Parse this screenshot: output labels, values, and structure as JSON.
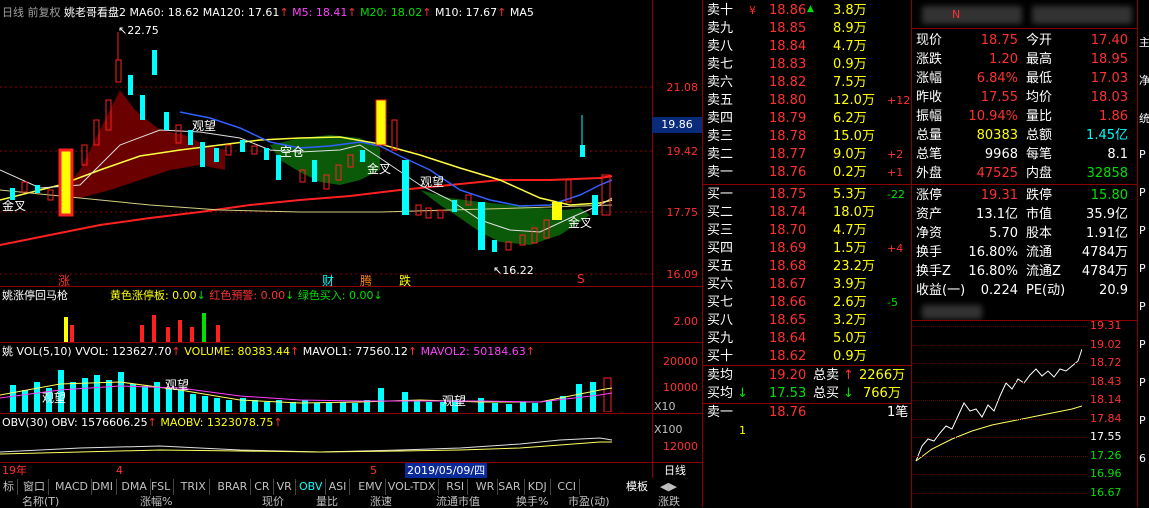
{
  "chart_header": {
    "period": "日线 前复权",
    "indicator": "姚老哥看盘2",
    "ma60": "MA60: 18.62",
    "ma120": "MA120: 17.61",
    "m5": "M5: 18.41",
    "m20": "M20: 18.02",
    "m10": "M10: 17.67",
    "ma_more": "MA5"
  },
  "price_axis": [
    "21.08",
    "19.42",
    "17.75",
    "16.09"
  ],
  "current_price_tag": "19.86",
  "annotations": {
    "high": "22.75",
    "low": "16.22",
    "guanwang1": "观望",
    "guanwang2": "观望",
    "kongcang": "空仓",
    "jinchai1": "金叉",
    "jinchai2": "金叉",
    "jinchai3": "金叉",
    "zhang": "涨",
    "cai": "财",
    "sheng": "腾",
    "die": "跌",
    "s": "S"
  },
  "limit_panel": {
    "title": "姚涨停回马枪",
    "yellow": "黄色涨停板: 0.00",
    "red": "红色預警: 0.00",
    "green": "绿色买入: 0.00",
    "axis": "2.00"
  },
  "vol_panel": {
    "title": "姚 VOL(5,10)",
    "vvol": "VVOL: 123627.70",
    "volume": "VOLUME: 80383.44",
    "mavol1": "MAVOL1: 77560.12",
    "mavol2": "MAVOL2: 50184.63",
    "axis": [
      "20000",
      "10000",
      "X10"
    ],
    "guanwang_a": "观望",
    "guanwang_b": "观望",
    "guanwang_c": "观望"
  },
  "obv_panel": {
    "title": "OBV(30)",
    "obv": "OBV: 1576606.25",
    "maobv": "MAOBV: 1323078.75",
    "axis": [
      "X100",
      "12000"
    ]
  },
  "date_bar": {
    "left": "19年",
    "m4": "4",
    "m5": "5",
    "selected": "2019/05/09/四",
    "period_btn": "日线"
  },
  "tabs": [
    "标",
    "窗口",
    "MACD",
    "DMI",
    "DMA",
    "FSL",
    "TRIX",
    "BRAR",
    "CR",
    "VR",
    "OBV",
    "ASI",
    "EMV",
    "VOL-TDX",
    "RSI",
    "WR",
    "SAR",
    "KDJ",
    "CCI"
  ],
  "tabs_active": "OBV",
  "tabs_right": "模板",
  "bottom_cols": [
    "名称(T)",
    "涨幅%",
    "现价",
    "量比",
    "涨速",
    "流通市值",
    "换手%",
    "市盈(动)",
    "涨跌"
  ],
  "orderbook": {
    "sell": [
      {
        "label": "卖十",
        "price": "18.86",
        "vol": "3.8万",
        "chg": ""
      },
      {
        "label": "卖九",
        "price": "18.85",
        "vol": "8.9万",
        "chg": ""
      },
      {
        "label": "卖八",
        "price": "18.84",
        "vol": "4.7万",
        "chg": ""
      },
      {
        "label": "卖七",
        "price": "18.83",
        "vol": "0.9万",
        "chg": ""
      },
      {
        "label": "卖六",
        "price": "18.82",
        "vol": "7.5万",
        "chg": ""
      },
      {
        "label": "卖五",
        "price": "18.80",
        "vol": "12.0万",
        "chg": "+12"
      },
      {
        "label": "卖四",
        "price": "18.79",
        "vol": "6.2万",
        "chg": ""
      },
      {
        "label": "卖三",
        "price": "18.78",
        "vol": "15.0万",
        "chg": ""
      },
      {
        "label": "卖二",
        "price": "18.77",
        "vol": "9.0万",
        "chg": "+2"
      },
      {
        "label": "卖一",
        "price": "18.76",
        "vol": "0.2万",
        "chg": "+1"
      }
    ],
    "buy": [
      {
        "label": "买一",
        "price": "18.75",
        "vol": "5.3万",
        "chg": "-22"
      },
      {
        "label": "买二",
        "price": "18.74",
        "vol": "18.0万",
        "chg": ""
      },
      {
        "label": "买三",
        "price": "18.70",
        "vol": "4.7万",
        "chg": ""
      },
      {
        "label": "买四",
        "price": "18.69",
        "vol": "1.5万",
        "chg": "+4"
      },
      {
        "label": "买五",
        "price": "18.68",
        "vol": "23.2万",
        "chg": ""
      },
      {
        "label": "买六",
        "price": "18.67",
        "vol": "3.9万",
        "chg": ""
      },
      {
        "label": "买七",
        "price": "18.66",
        "vol": "2.6万",
        "chg": "-5"
      },
      {
        "label": "买八",
        "price": "18.65",
        "vol": "3.2万",
        "chg": ""
      },
      {
        "label": "买九",
        "price": "18.64",
        "vol": "5.0万",
        "chg": ""
      },
      {
        "label": "买十",
        "price": "18.62",
        "vol": "0.9万",
        "chg": ""
      }
    ],
    "sell_avg_label": "卖均",
    "sell_avg": "19.20",
    "total_sell_label": "总卖",
    "total_sell": "2266万",
    "buy_avg_label": "买均",
    "buy_avg": "17.53",
    "total_buy_label": "总买",
    "total_buy": "766万",
    "trade_label": "卖一",
    "trade_price": "18.76",
    "trade_vol": "1笔",
    "sub_value": "1",
    "yen": "¥"
  },
  "quote": {
    "rows": [
      {
        "l1": "现价",
        "v1": "18.75",
        "l2": "今开",
        "v2": "17.40"
      },
      {
        "l1": "涨跌",
        "v1": "1.20",
        "l2": "最高",
        "v2": "18.95"
      },
      {
        "l1": "涨幅",
        "v1": "6.84%",
        "l2": "最低",
        "v2": "17.03"
      },
      {
        "l1": "昨收",
        "v1": "17.55",
        "l2": "均价",
        "v2": "18.03"
      },
      {
        "l1": "振幅",
        "v1": "10.94%",
        "l2": "量比",
        "v2": "1.86"
      },
      {
        "l1": "总量",
        "v1": "80383",
        "l2": "总额",
        "v2": "1.45亿"
      },
      {
        "l1": "总笔",
        "v1": "9968",
        "l2": "每笔",
        "v2": "8.1"
      },
      {
        "l1": "外盘",
        "v1": "47525",
        "l2": "内盘",
        "v2": "32858"
      }
    ],
    "rows2": [
      {
        "l1": "涨停",
        "v1": "19.31",
        "l2": "跌停",
        "v2": "15.80"
      },
      {
        "l1": "资产",
        "v1": "13.1亿",
        "l2": "市值",
        "v2": "35.9亿"
      },
      {
        "l1": "净资",
        "v1": "5.70",
        "l2": "股本",
        "v2": "1.91亿"
      },
      {
        "l1": "换手",
        "v1": "16.80%",
        "l2": "流通",
        "v2": "4784万"
      },
      {
        "l1": "换手Z",
        "v1": "16.80%",
        "l2": "流通Z",
        "v2": "4784万"
      },
      {
        "l1": "收益(一)",
        "v1": "0.224",
        "l2": "PE(动)",
        "v2": "20.9"
      }
    ],
    "top_label": "N"
  },
  "mini_axis": [
    "19.31",
    "19.02",
    "18.72",
    "18.43",
    "18.14",
    "17.84",
    "17.55",
    "17.26",
    "16.96",
    "16.67"
  ],
  "right_edge": [
    "主",
    "净",
    "统",
    "P",
    "P",
    "P",
    "P",
    "P",
    "P",
    "P",
    "P",
    "6"
  ]
}
